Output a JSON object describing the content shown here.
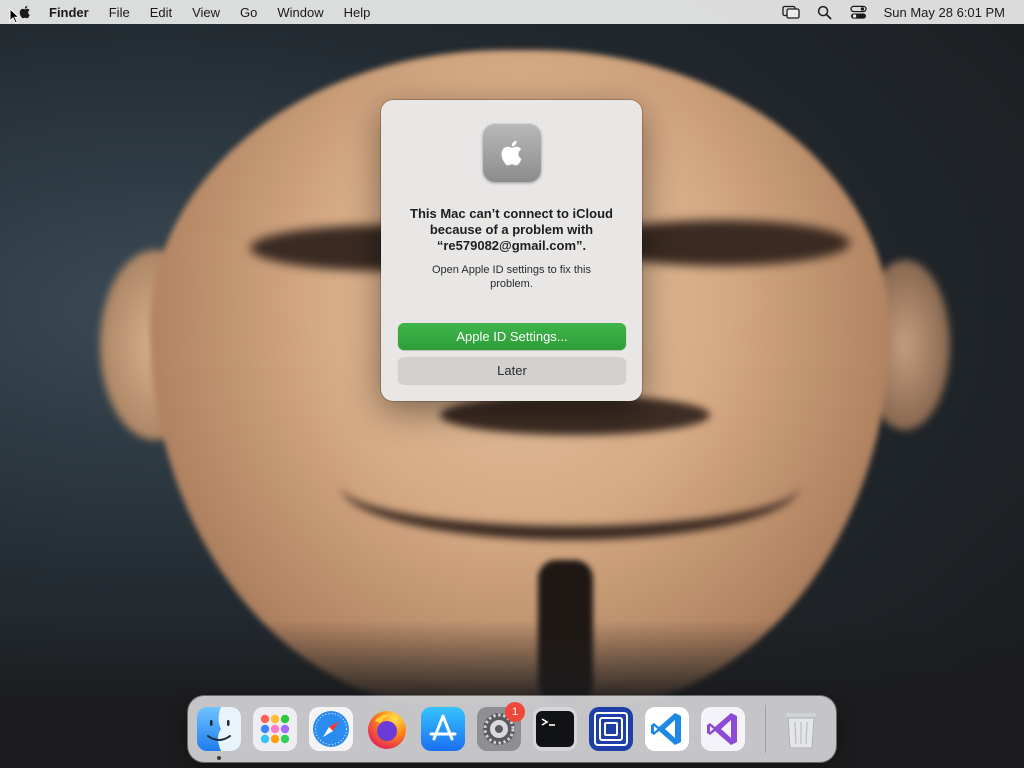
{
  "menubar": {
    "app_name": "Finder",
    "menus": [
      "File",
      "Edit",
      "View",
      "Go",
      "Window",
      "Help"
    ],
    "clock": "Sun May 28  6:01 PM"
  },
  "dialog": {
    "title": "This Mac can’t connect to iCloud because of a problem with “re579082@gmail.com”.",
    "message": "Open Apple ID settings to fix this problem.",
    "primary_button": "Apple ID Settings...",
    "secondary_button": "Later",
    "primary_color": "#33a83e"
  },
  "dock": {
    "system_settings_badge": "1"
  }
}
